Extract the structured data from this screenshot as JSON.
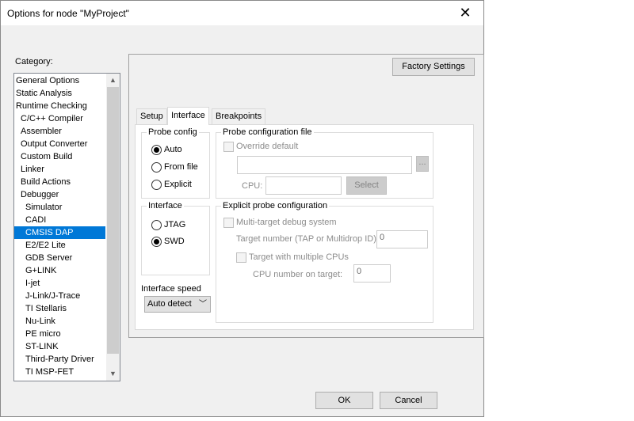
{
  "window": {
    "title": "Options for node \"MyProject\"",
    "close_glyph": "✕"
  },
  "category": {
    "label": "Category:",
    "items": [
      {
        "label": "General Options",
        "indent": 0
      },
      {
        "label": "Static Analysis",
        "indent": 0
      },
      {
        "label": "Runtime Checking",
        "indent": 0
      },
      {
        "label": "C/C++ Compiler",
        "indent": 1
      },
      {
        "label": "Assembler",
        "indent": 1
      },
      {
        "label": "Output Converter",
        "indent": 1
      },
      {
        "label": "Custom Build",
        "indent": 1
      },
      {
        "label": "Linker",
        "indent": 1
      },
      {
        "label": "Build Actions",
        "indent": 1
      },
      {
        "label": "Debugger",
        "indent": 1
      },
      {
        "label": "Simulator",
        "indent": 2
      },
      {
        "label": "CADI",
        "indent": 2
      },
      {
        "label": "CMSIS DAP",
        "indent": 2,
        "selected": true
      },
      {
        "label": "E2/E2 Lite",
        "indent": 2
      },
      {
        "label": "GDB Server",
        "indent": 2
      },
      {
        "label": "G+LINK",
        "indent": 2
      },
      {
        "label": "I-jet",
        "indent": 2
      },
      {
        "label": "J-Link/J-Trace",
        "indent": 2
      },
      {
        "label": "TI Stellaris",
        "indent": 2
      },
      {
        "label": "Nu-Link",
        "indent": 2
      },
      {
        "label": "PE micro",
        "indent": 2
      },
      {
        "label": "ST-LINK",
        "indent": 2
      },
      {
        "label": "Third-Party Driver",
        "indent": 2
      },
      {
        "label": "TI MSP-FET",
        "indent": 2
      }
    ],
    "scroll_up": "▲",
    "scroll_down": "▼"
  },
  "factory_settings": "Factory Settings",
  "tabs": [
    "Setup",
    "Interface",
    "Breakpoints"
  ],
  "active_tab": "Interface",
  "probe_config": {
    "legend": "Probe config",
    "options": [
      "Auto",
      "From file",
      "Explicit"
    ],
    "selected": "Auto"
  },
  "probe_file": {
    "legend": "Probe configuration file",
    "override_label": "Override default",
    "override_checked": false,
    "path_value": "",
    "browse_label": "...",
    "cpu_label": "CPU:",
    "cpu_value": "",
    "select_label": "Select"
  },
  "interface": {
    "legend": "Interface",
    "options": [
      "JTAG",
      "SWD"
    ],
    "selected": "SWD"
  },
  "explicit": {
    "legend": "Explicit probe configuration",
    "multi_target_label": "Multi-target debug system",
    "target_number_label": "Target number (TAP or Multidrop ID):",
    "target_number_value": "0",
    "multi_cpu_label": "Target with multiple CPUs",
    "cpu_number_label": "CPU number on target:",
    "cpu_number_value": "0"
  },
  "interface_speed": {
    "label": "Interface speed",
    "value": "Auto detect",
    "chevron": "﹀"
  },
  "buttons": {
    "ok": "OK",
    "cancel": "Cancel"
  }
}
